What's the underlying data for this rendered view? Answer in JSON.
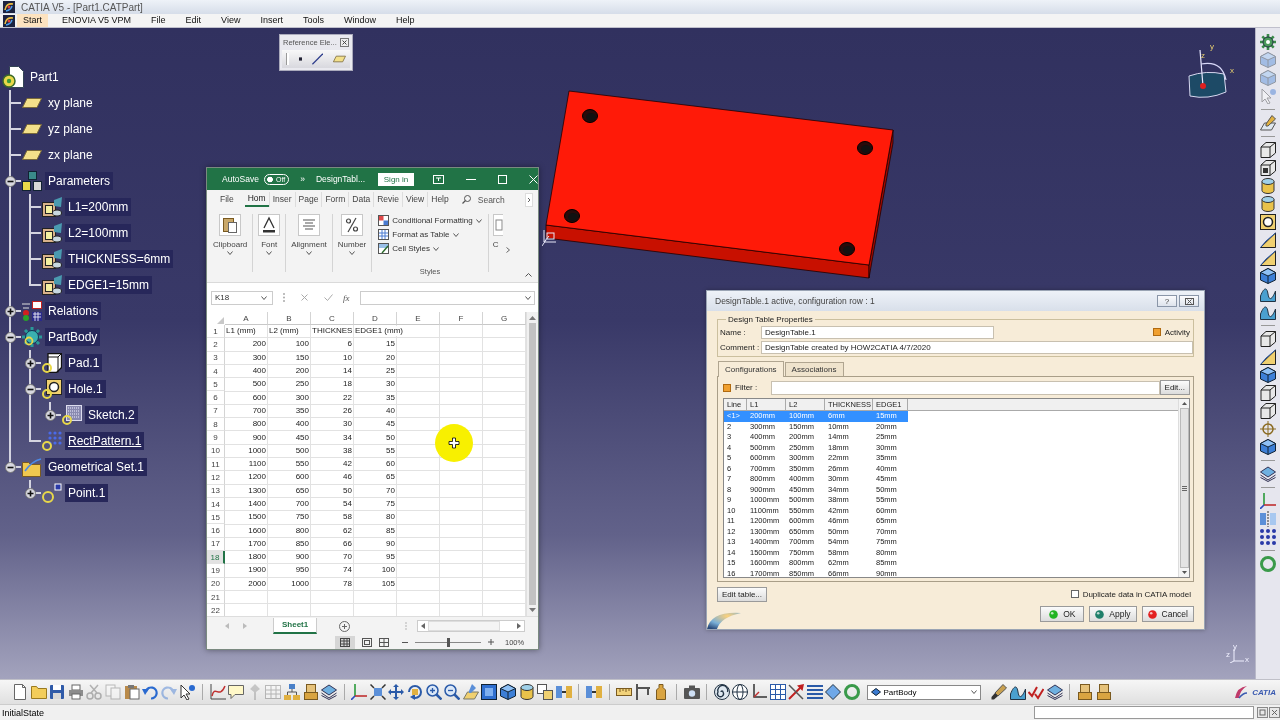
{
  "window": {
    "title": "CATIA V5 - [Part1.CATPart]"
  },
  "menu": [
    {
      "label": "Start",
      "selected": true
    },
    {
      "label": "ENOVIA V5 VPM",
      "selected": false
    },
    {
      "label": "File",
      "selected": false
    },
    {
      "label": "Edit",
      "selected": false
    },
    {
      "label": "View",
      "selected": false
    },
    {
      "label": "Insert",
      "selected": false
    },
    {
      "label": "Tools",
      "selected": false
    },
    {
      "label": "Window",
      "selected": false
    },
    {
      "label": "Help",
      "selected": false
    }
  ],
  "reference_toolbar": {
    "title": "Reference Ele..."
  },
  "tree": {
    "label": "Part1",
    "kind": "part",
    "in_work": false,
    "children": [
      {
        "label": "xy plane",
        "kind": "plane",
        "in_work": false
      },
      {
        "label": "yz plane",
        "kind": "plane",
        "in_work": false
      },
      {
        "label": "zx plane",
        "kind": "plane",
        "in_work": false
      },
      {
        "label": "Parameters",
        "kind": "parameters",
        "expanded": true,
        "in_work": false,
        "children": [
          {
            "label": "L1=200mm",
            "kind": "parameter",
            "in_work": false
          },
          {
            "label": "L2=100mm",
            "kind": "parameter",
            "in_work": false
          },
          {
            "label": "THICKNESS=6mm",
            "kind": "parameter",
            "in_work": false
          },
          {
            "label": "EDGE1=15mm",
            "kind": "parameter",
            "in_work": false
          }
        ]
      },
      {
        "label": "Relations",
        "kind": "relations",
        "expanded": false,
        "in_work": false
      },
      {
        "label": "PartBody",
        "kind": "body",
        "expanded": true,
        "in_work": false,
        "children": [
          {
            "label": "Pad.1",
            "kind": "pad",
            "expanded": false,
            "in_work": false
          },
          {
            "label": "Hole.1",
            "kind": "hole",
            "expanded": true,
            "in_work": false,
            "children": [
              {
                "label": "Sketch.2",
                "kind": "sketch",
                "expanded": false,
                "in_work": false
              }
            ]
          },
          {
            "label": "RectPattern.1",
            "kind": "pattern",
            "in_work": true
          }
        ]
      },
      {
        "label": "Geometrical Set.1",
        "kind": "geoset",
        "expanded": true,
        "in_work": false,
        "children": [
          {
            "label": "Point.1",
            "kind": "point",
            "expanded": false,
            "in_work": false
          }
        ]
      }
    ]
  },
  "excel": {
    "autosave": {
      "label": "AutoSave",
      "on": false,
      "state_text": "Off"
    },
    "overflow": "»",
    "title": "DesignTabl...",
    "sign_in": "Sign in",
    "tabs": [
      {
        "label": "File",
        "selected": false
      },
      {
        "label": "Hom",
        "selected": true
      },
      {
        "label": "Inser",
        "selected": false
      },
      {
        "label": "Page",
        "selected": false
      },
      {
        "label": "Form",
        "selected": false
      },
      {
        "label": "Data",
        "selected": false
      },
      {
        "label": "Revie",
        "selected": false
      },
      {
        "label": "View",
        "selected": false
      },
      {
        "label": "Help",
        "selected": false
      }
    ],
    "search": "Search",
    "groups": [
      {
        "label": "Clipboard",
        "kind": "clipboard"
      },
      {
        "label": "Font",
        "kind": "font"
      },
      {
        "label": "Alignment",
        "kind": "alignment"
      },
      {
        "label": "Number",
        "kind": "number"
      }
    ],
    "style_commands": [
      {
        "label": "Conditional Formatting",
        "kind": "conditional"
      },
      {
        "label": "Format as Table",
        "kind": "table"
      },
      {
        "label": "Cell Styles",
        "kind": "cell"
      }
    ],
    "styles_label": "Styles",
    "cut_group": "C",
    "name_box": "K18",
    "formula_symbol": "fx",
    "columns": [
      "A",
      "B",
      "C",
      "D",
      "E",
      "F",
      "G"
    ],
    "rows": [
      {
        "number": "1",
        "kind": "text",
        "selected": false,
        "cells": [
          "L1 (mm)",
          "L2 (mm)",
          "THICKNES",
          "EDGE1 (mm)"
        ]
      },
      {
        "number": "2",
        "kind": "number",
        "selected": false,
        "cells": [
          "200",
          "100",
          "6",
          "15"
        ]
      },
      {
        "number": "3",
        "kind": "number",
        "selected": false,
        "cells": [
          "300",
          "150",
          "10",
          "20"
        ]
      },
      {
        "number": "4",
        "kind": "number",
        "selected": false,
        "cells": [
          "400",
          "200",
          "14",
          "25"
        ]
      },
      {
        "number": "5",
        "kind": "number",
        "selected": false,
        "cells": [
          "500",
          "250",
          "18",
          "30"
        ]
      },
      {
        "number": "6",
        "kind": "number",
        "selected": false,
        "cells": [
          "600",
          "300",
          "22",
          "35"
        ]
      },
      {
        "number": "7",
        "kind": "number",
        "selected": false,
        "cells": [
          "700",
          "350",
          "26",
          "40"
        ]
      },
      {
        "number": "8",
        "kind": "number",
        "selected": false,
        "cells": [
          "800",
          "400",
          "30",
          "45"
        ]
      },
      {
        "number": "9",
        "kind": "number",
        "selected": false,
        "cells": [
          "900",
          "450",
          "34",
          "50"
        ]
      },
      {
        "number": "10",
        "kind": "number",
        "selected": false,
        "cells": [
          "1000",
          "500",
          "38",
          "55"
        ]
      },
      {
        "number": "11",
        "kind": "number",
        "selected": false,
        "cells": [
          "1100",
          "550",
          "42",
          "60"
        ]
      },
      {
        "number": "12",
        "kind": "number",
        "selected": false,
        "cells": [
          "1200",
          "600",
          "46",
          "65"
        ]
      },
      {
        "number": "13",
        "kind": "number",
        "selected": false,
        "cells": [
          "1300",
          "650",
          "50",
          "70"
        ]
      },
      {
        "number": "14",
        "kind": "number",
        "selected": false,
        "cells": [
          "1400",
          "700",
          "54",
          "75"
        ]
      },
      {
        "number": "15",
        "kind": "number",
        "selected": false,
        "cells": [
          "1500",
          "750",
          "58",
          "80"
        ]
      },
      {
        "number": "16",
        "kind": "number",
        "selected": false,
        "cells": [
          "1600",
          "800",
          "62",
          "85"
        ]
      },
      {
        "number": "17",
        "kind": "number",
        "selected": false,
        "cells": [
          "1700",
          "850",
          "66",
          "90"
        ]
      },
      {
        "number": "18",
        "kind": "number",
        "selected": true,
        "cells": [
          "1800",
          "900",
          "70",
          "95"
        ]
      },
      {
        "number": "19",
        "kind": "number",
        "selected": false,
        "cells": [
          "1900",
          "950",
          "74",
          "100"
        ]
      },
      {
        "number": "20",
        "kind": "number",
        "selected": false,
        "cells": [
          "2000",
          "1000",
          "78",
          "105"
        ]
      },
      {
        "number": "21",
        "kind": "empty",
        "selected": false
      },
      {
        "number": "22",
        "kind": "empty",
        "selected": false
      }
    ],
    "sheet_tab": {
      "label": "Sheet1",
      "selected": true
    },
    "zoom_slider": {
      "level": 0.5
    },
    "zoom": "100%"
  },
  "design_table": {
    "title": "DesignTable.1 active, configuration row : 1",
    "help_button": "?",
    "group_title": "Design Table Properties",
    "name_label": "Name :",
    "name_value": "DesignTable.1",
    "activity": {
      "label": "Activity",
      "checked": true
    },
    "comment_label": "Comment :",
    "comment_value": "DesignTable created by HOW2CATIA 4/7/2020",
    "tabs": [
      {
        "label": "Configurations",
        "selected": true
      },
      {
        "label": "Associations",
        "selected": false
      }
    ],
    "filter": {
      "label": "Filter :",
      "checked": true
    },
    "filter_edit": "Edit...",
    "columns": [
      "Line",
      "L1",
      "L2",
      "THICKNESS",
      "EDGE1"
    ],
    "rows": [
      {
        "selected": true,
        "cells": [
          "<1>",
          "200mm",
          "100mm",
          "6mm",
          "15mm"
        ]
      },
      {
        "selected": false,
        "cells": [
          "2",
          "300mm",
          "150mm",
          "10mm",
          "20mm"
        ]
      },
      {
        "selected": false,
        "cells": [
          "3",
          "400mm",
          "200mm",
          "14mm",
          "25mm"
        ]
      },
      {
        "selected": false,
        "cells": [
          "4",
          "500mm",
          "250mm",
          "18mm",
          "30mm"
        ]
      },
      {
        "selected": false,
        "cells": [
          "5",
          "600mm",
          "300mm",
          "22mm",
          "35mm"
        ]
      },
      {
        "selected": false,
        "cells": [
          "6",
          "700mm",
          "350mm",
          "26mm",
          "40mm"
        ]
      },
      {
        "selected": false,
        "cells": [
          "7",
          "800mm",
          "400mm",
          "30mm",
          "45mm"
        ]
      },
      {
        "selected": false,
        "cells": [
          "8",
          "900mm",
          "450mm",
          "34mm",
          "50mm"
        ]
      },
      {
        "selected": false,
        "cells": [
          "9",
          "1000mm",
          "500mm",
          "38mm",
          "55mm"
        ]
      },
      {
        "selected": false,
        "cells": [
          "10",
          "1100mm",
          "550mm",
          "42mm",
          "60mm"
        ]
      },
      {
        "selected": false,
        "cells": [
          "11",
          "1200mm",
          "600mm",
          "46mm",
          "65mm"
        ]
      },
      {
        "selected": false,
        "cells": [
          "12",
          "1300mm",
          "650mm",
          "50mm",
          "70mm"
        ]
      },
      {
        "selected": false,
        "cells": [
          "13",
          "1400mm",
          "700mm",
          "54mm",
          "75mm"
        ]
      },
      {
        "selected": false,
        "cells": [
          "14",
          "1500mm",
          "750mm",
          "58mm",
          "80mm"
        ]
      },
      {
        "selected": false,
        "cells": [
          "15",
          "1600mm",
          "800mm",
          "62mm",
          "85mm"
        ]
      },
      {
        "selected": false,
        "cells": [
          "16",
          "1700mm",
          "850mm",
          "66mm",
          "90mm"
        ]
      }
    ],
    "edit_table": "Edit table...",
    "duplicate": {
      "label": "Duplicate data in CATIA model",
      "checked": false
    },
    "buttons": [
      {
        "label": "OK",
        "kind": "ok"
      },
      {
        "label": "Apply",
        "kind": "apply"
      },
      {
        "label": "Cancel",
        "kind": "cancel"
      }
    ]
  },
  "compass": {
    "axes": [
      "y",
      "z",
      "x"
    ]
  },
  "triad": {
    "axes": [
      "y",
      "z",
      "x"
    ]
  },
  "part_selector": "PartBody",
  "logo_text": "CATIA",
  "status_text": "InitialState"
}
